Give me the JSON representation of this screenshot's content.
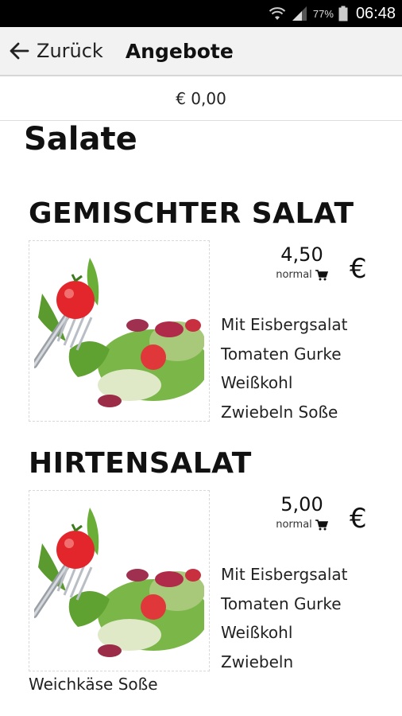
{
  "status_bar": {
    "battery": "77%",
    "time": "06:48",
    "icons": [
      "wifi-icon",
      "signal-icon",
      "battery-icon"
    ]
  },
  "app_bar": {
    "back_label": "Zurück",
    "title": "Angebote"
  },
  "cart": {
    "total": "€ 0,00"
  },
  "category": {
    "title": "Salate"
  },
  "products": [
    {
      "name": "GEMISCHTER SALAT",
      "price": "4,50",
      "size": "normal",
      "currency": "€",
      "description_lines": [
        "Mit Eisbergsalat",
        "Tomaten Gurke",
        "Weißkohl",
        "Zwiebeln Soße"
      ]
    },
    {
      "name": "HIRTENSALAT",
      "price": "5,00",
      "size": "normal",
      "currency": "€",
      "description_lines": [
        "Mit Eisbergsalat",
        "Tomaten Gurke",
        "Weißkohl",
        "Zwiebeln"
      ],
      "description_tail": "Weichkäse Soße"
    }
  ],
  "colors": {
    "status_bar_bg": "#000000",
    "app_bar_bg": "#f2f2f2",
    "text": "#111111"
  }
}
